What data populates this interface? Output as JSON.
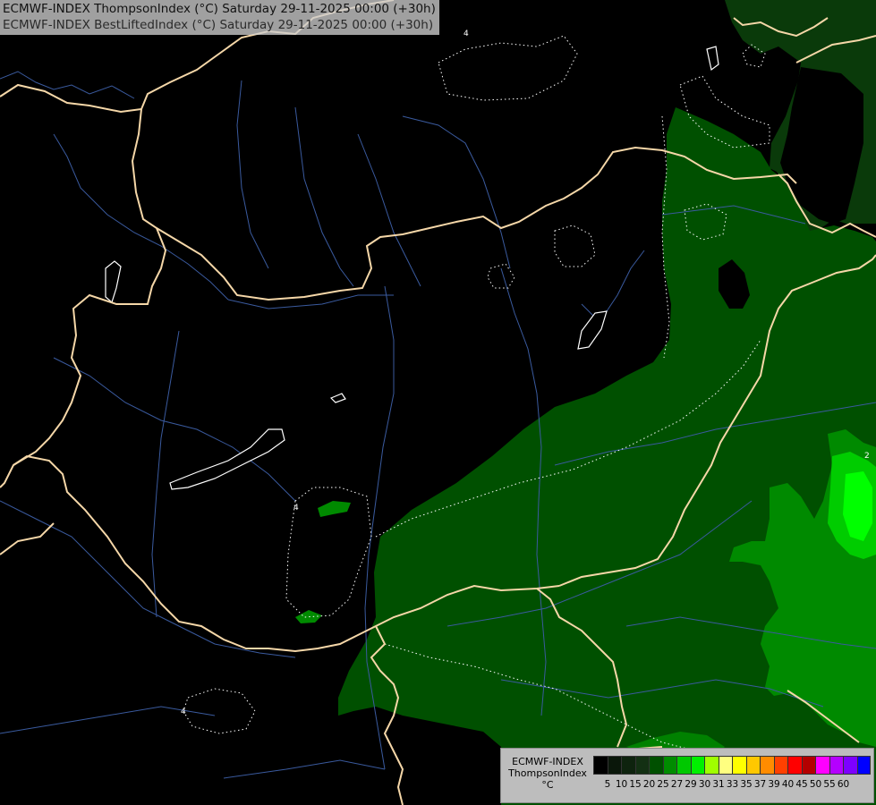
{
  "header": {
    "title_line_1": "ECMWF-INDEX ThompsonIndex (°C) Saturday 29-11-2025 00:00 (+30h)",
    "title_line_2": "ECMWF-INDEX BestLiftedIndex (°C) Saturday 29-11-2025 00:00 (+30h)"
  },
  "legend": {
    "model": "ECMWF-INDEX",
    "parameter": "ThompsonIndex",
    "unit": "°C",
    "labels": [
      "5",
      "10",
      "15",
      "20",
      "25",
      "27",
      "29",
      "30",
      "31",
      "33",
      "35",
      "37",
      "39",
      "40",
      "45",
      "50",
      "55",
      "60"
    ],
    "colors": [
      "#000000",
      "#0a170a",
      "#0e230e",
      "#133013",
      "#005000",
      "#008c00",
      "#00c800",
      "#00f000",
      "#a0ff00",
      "#ffff80",
      "#ffff00",
      "#ffc800",
      "#ff8c00",
      "#ff4000",
      "#ff0000",
      "#b40000",
      "#ff00ff",
      "#b400ff",
      "#7d00ff",
      "#0000ff"
    ]
  },
  "map": {
    "colors": {
      "level_20": "#0a3a0a",
      "level_25": "#005000",
      "level_27": "#008a00",
      "level_29": "#00cc00",
      "level_30": "#00ff00",
      "border": "#f5d7a8",
      "river": "#3a5a9e",
      "lake": "#000000",
      "dotted_contour": "#ffffff"
    },
    "contour_labels": [
      "4",
      "4",
      "4",
      "2"
    ]
  }
}
